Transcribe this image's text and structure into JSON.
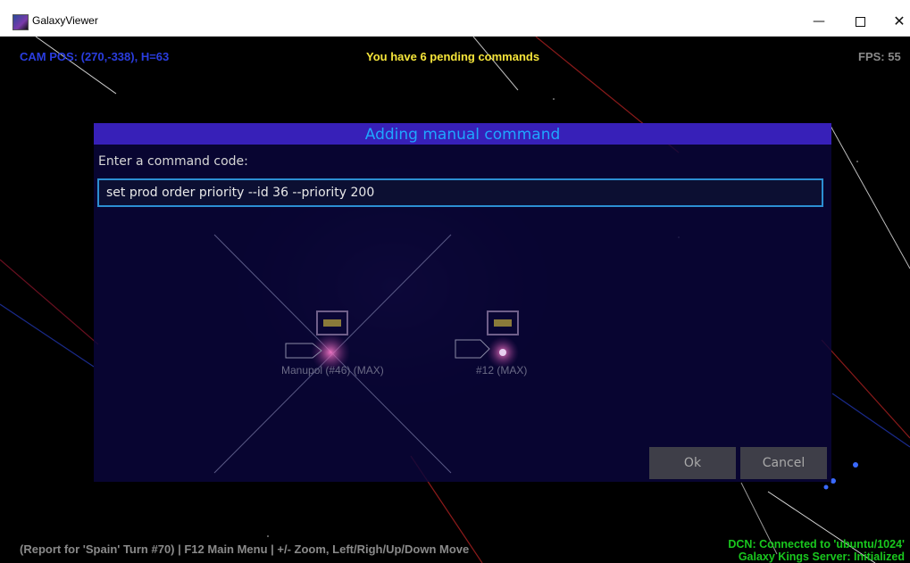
{
  "window": {
    "title": "GalaxyViewer",
    "minimize_icon": "minimize-icon",
    "maximize_icon": "maximize-icon",
    "close_icon": "close-icon",
    "minimize_glyph": "—",
    "close_glyph": "✕"
  },
  "hud": {
    "cam_pos": "CAM POS: (270,-338), H=63",
    "pending": "You have 6 pending commands",
    "fps": "FPS: 55",
    "report": "(Report for 'Spain' Turn #70) | F12 Main Menu | +/- Zoom, Left/Righ/Up/Down Move",
    "dcn_line1": "DCN: Connected to 'ubuntu/1024'",
    "dcn_line2": "Galaxy Kings Server: Initialized"
  },
  "map": {
    "ships": [
      {
        "label": "Manupol (#46) (MAX)"
      },
      {
        "label": "#12 (MAX)"
      }
    ]
  },
  "dialog": {
    "title": "Adding manual command",
    "prompt": "Enter a command code:",
    "command_value": "set prod order priority --id 36 --priority 200",
    "ok_label": "Ok",
    "cancel_label": "Cancel"
  },
  "colors": {
    "cam_text": "#2a3de0",
    "pending_text": "#f5e53a",
    "dcn_text": "#19c81e",
    "dialog_header": "#3720b8",
    "dialog_title": "#1fa6ff",
    "input_border": "#2c8fd2"
  }
}
